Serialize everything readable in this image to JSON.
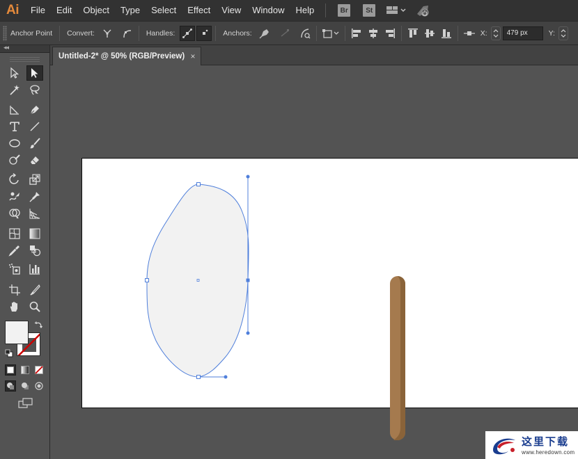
{
  "app": {
    "logo_text": "Ai",
    "accent_color": "#E58A3B"
  },
  "menubar": {
    "items": [
      "File",
      "Edit",
      "Object",
      "Type",
      "Select",
      "Effect",
      "View",
      "Window",
      "Help"
    ],
    "bridge_label": "Br",
    "stock_label": "St"
  },
  "controlbar": {
    "mode_label": "Anchor Point",
    "convert_label": "Convert:",
    "handles_label": "Handles:",
    "anchors_label": "Anchors:",
    "x_label": "X:",
    "x_value": "479 px",
    "y_label": "Y:"
  },
  "document": {
    "tab_title": "Untitled-2* @ 50% (RGB/Preview)",
    "close_glyph": "×"
  },
  "tools": [
    {
      "name": "selection-tool",
      "active": false
    },
    {
      "name": "direct-selection-tool",
      "active": true
    },
    {
      "name": "magic-wand-tool",
      "active": false
    },
    {
      "name": "lasso-tool",
      "active": false
    },
    {
      "name": "curvature-tool",
      "active": false
    },
    {
      "name": "pen-tool",
      "active": false
    },
    {
      "name": "type-tool",
      "active": false
    },
    {
      "name": "line-segment-tool",
      "active": false
    },
    {
      "name": "ellipse-tool",
      "active": false
    },
    {
      "name": "paintbrush-tool",
      "active": false
    },
    {
      "name": "shaper-tool",
      "active": false
    },
    {
      "name": "eraser-tool",
      "active": false
    },
    {
      "name": "rotate-tool",
      "active": false
    },
    {
      "name": "scale-tool",
      "active": false
    },
    {
      "name": "warp-tool",
      "active": false
    },
    {
      "name": "puppet-warp-tool",
      "active": false
    },
    {
      "name": "shape-builder-tool",
      "active": false
    },
    {
      "name": "perspective-grid-tool",
      "active": false
    },
    {
      "name": "mesh-tool",
      "active": false
    },
    {
      "name": "gradient-tool",
      "active": false
    },
    {
      "name": "eyedropper-tool",
      "active": false
    },
    {
      "name": "blend-tool",
      "active": false
    },
    {
      "name": "symbol-sprayer-tool",
      "active": false
    },
    {
      "name": "column-graph-tool",
      "active": false
    },
    {
      "name": "artboard-tool",
      "active": false
    },
    {
      "name": "slice-tool",
      "active": false
    },
    {
      "name": "hand-tool",
      "active": false
    },
    {
      "name": "zoom-tool",
      "active": false
    }
  ],
  "colors": {
    "fill": "#f2f2f2",
    "stroke": "none",
    "path_selection": "#4f7fdb",
    "stick": "#a57a4e",
    "stick_shade": "#8a6339"
  },
  "watermark": {
    "text_cn": "这里下载",
    "url": "www.heredown.com"
  }
}
